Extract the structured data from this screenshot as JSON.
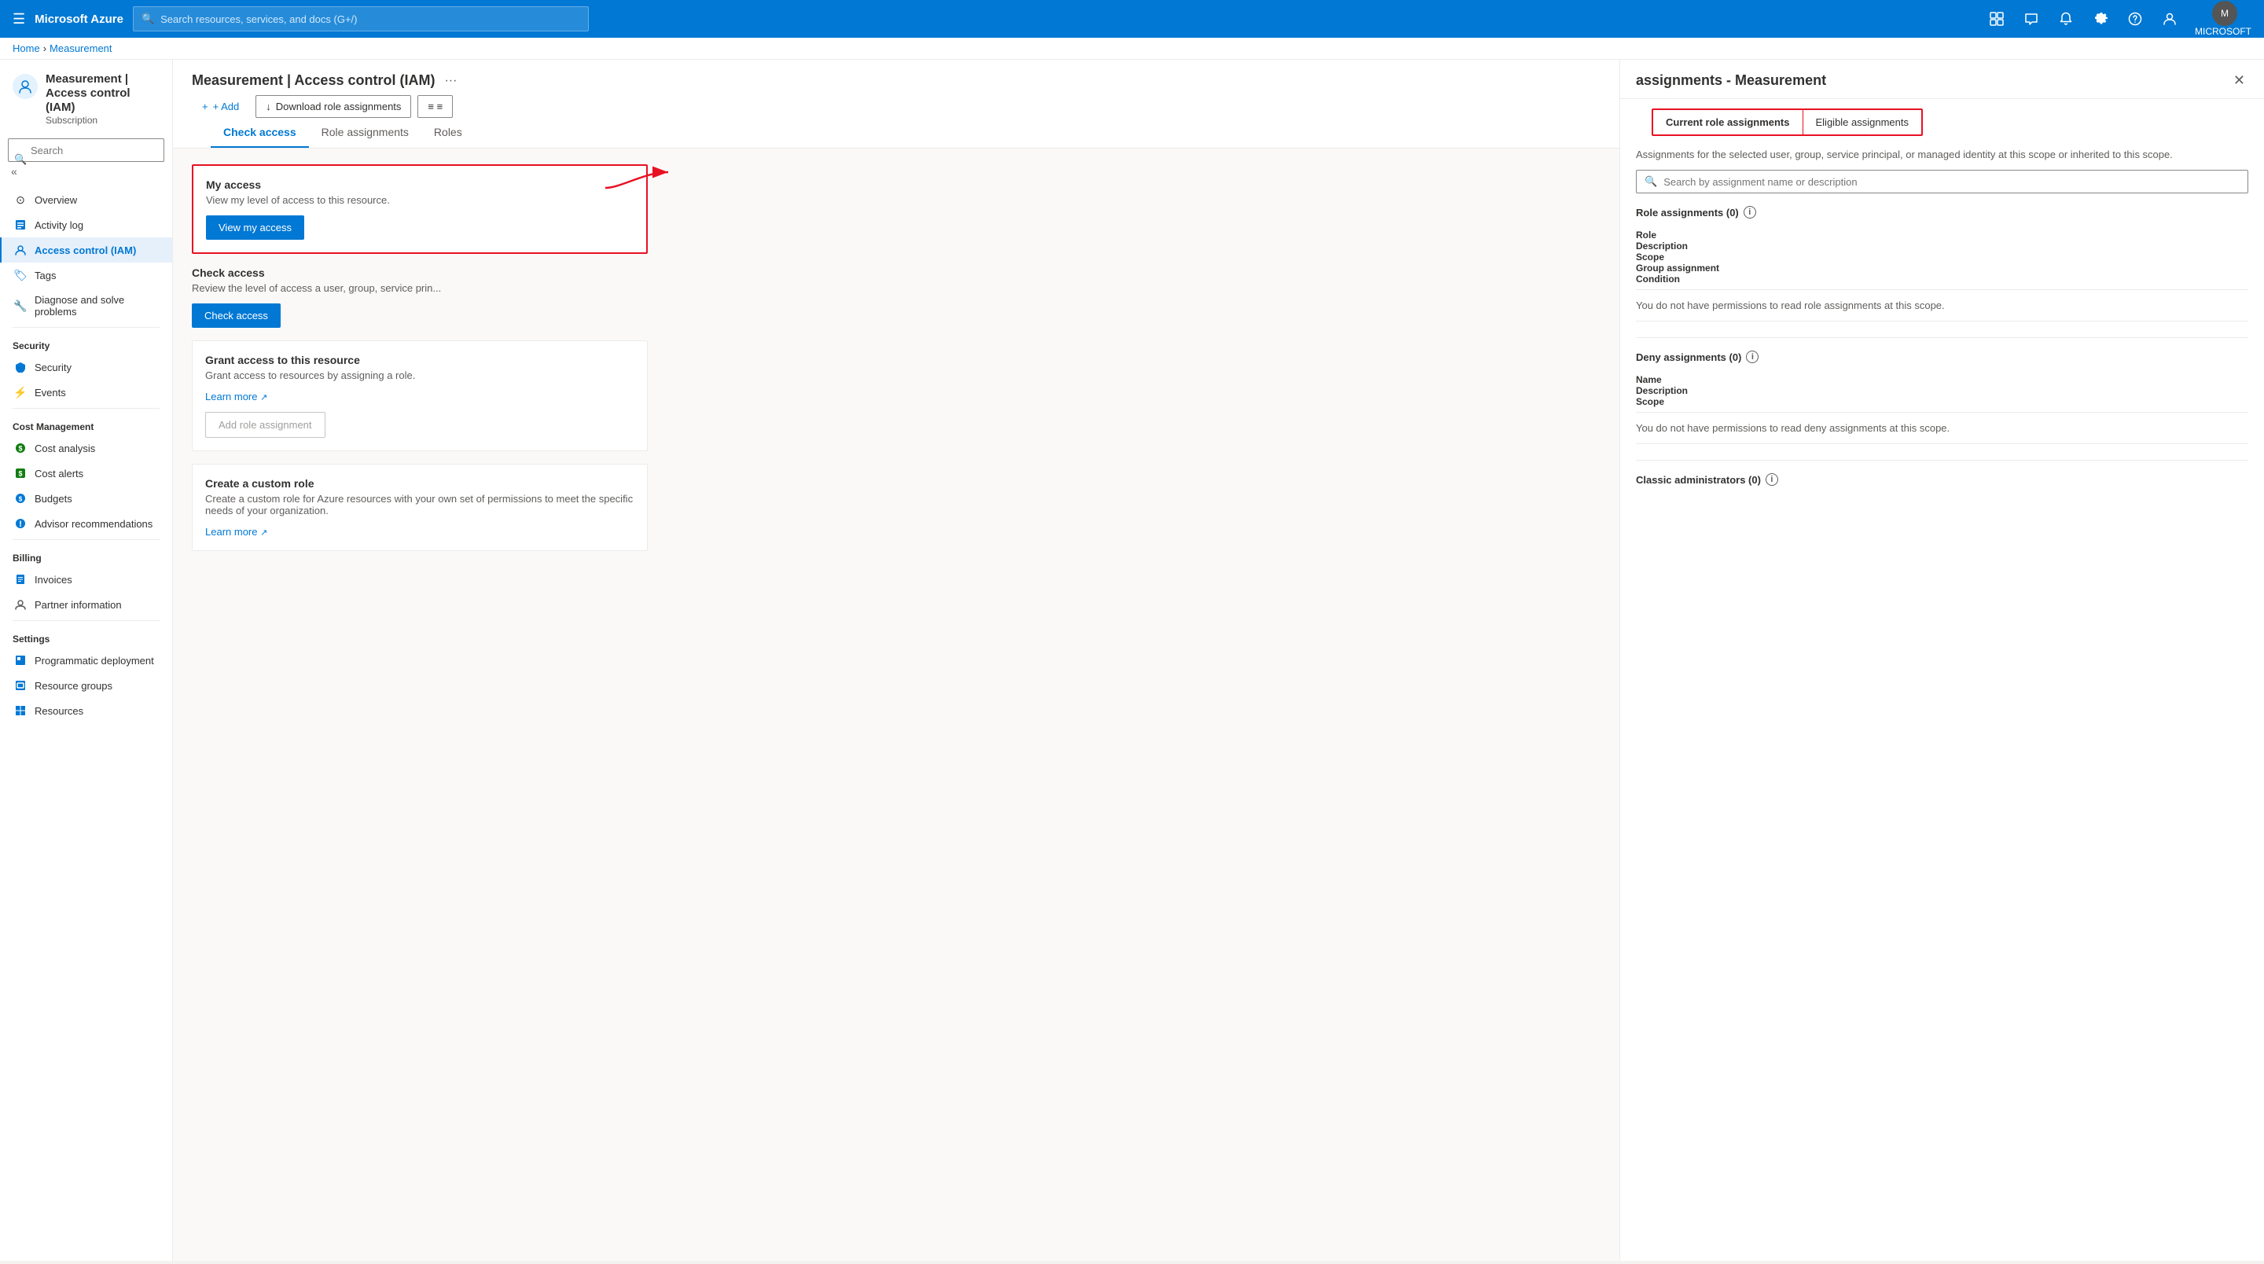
{
  "topNav": {
    "hamburger": "☰",
    "logo": "Microsoft Azure",
    "searchPlaceholder": "Search resources, services, and docs (G+/)",
    "userLabel": "MICROSOFT",
    "icons": [
      "portal",
      "feedback",
      "notifications",
      "settings",
      "help",
      "profile"
    ]
  },
  "breadcrumb": {
    "home": "Home",
    "current": "Measurement"
  },
  "sidebar": {
    "title": "Measurement | Access control (IAM)",
    "subtitle": "Subscription",
    "searchPlaceholder": "Search",
    "items": [
      {
        "id": "overview",
        "label": "Overview",
        "icon": "⊙",
        "color": "#0078d4"
      },
      {
        "id": "activity-log",
        "label": "Activity log",
        "icon": "📋",
        "color": "#0078d4"
      },
      {
        "id": "iam",
        "label": "Access control (IAM)",
        "icon": "👤",
        "color": "#0078d4",
        "active": true
      },
      {
        "id": "tags",
        "label": "Tags",
        "icon": "🏷",
        "color": "#0078d4"
      },
      {
        "id": "diagnose",
        "label": "Diagnose and solve problems",
        "icon": "🔧",
        "color": "#605e5c"
      }
    ],
    "sections": [
      {
        "label": "Security",
        "items": [
          {
            "id": "security",
            "label": "Security",
            "icon": "🛡",
            "color": "#0078d4"
          },
          {
            "id": "events",
            "label": "Events",
            "icon": "⚡",
            "color": "#f2c811"
          }
        ]
      },
      {
        "label": "Cost Management",
        "items": [
          {
            "id": "cost-analysis",
            "label": "Cost analysis",
            "icon": "💰",
            "color": "#107c10"
          },
          {
            "id": "cost-alerts",
            "label": "Cost alerts",
            "icon": "💲",
            "color": "#107c10"
          },
          {
            "id": "budgets",
            "label": "Budgets",
            "icon": "💼",
            "color": "#0078d4"
          },
          {
            "id": "advisor",
            "label": "Advisor recommendations",
            "icon": "💡",
            "color": "#0078d4"
          }
        ]
      },
      {
        "label": "Billing",
        "items": [
          {
            "id": "invoices",
            "label": "Invoices",
            "icon": "📄",
            "color": "#0078d4"
          },
          {
            "id": "partner-info",
            "label": "Partner information",
            "icon": "👤",
            "color": "#605e5c"
          }
        ]
      },
      {
        "label": "Settings",
        "items": [
          {
            "id": "programmatic",
            "label": "Programmatic deployment",
            "icon": "⬛",
            "color": "#0078d4"
          },
          {
            "id": "resource-groups",
            "label": "Resource groups",
            "icon": "⬛",
            "color": "#0078d4"
          },
          {
            "id": "resources",
            "label": "Resources",
            "icon": "⊞",
            "color": "#0078d4"
          }
        ]
      }
    ]
  },
  "pageHeader": {
    "title": "Measurement | Access control (IAM)",
    "toolbar": {
      "add": "+ Add",
      "download": "Download role assignments",
      "more": "≡ ≡"
    }
  },
  "tabs": {
    "items": [
      "Check access",
      "Role assignments",
      "Roles"
    ],
    "active": "Check access"
  },
  "checkAccess": {
    "myAccessCard": {
      "title": "My access",
      "description": "View my level of access to this resource.",
      "buttonLabel": "View my access"
    },
    "checkAccessCard": {
      "title": "Check access",
      "description": "Review the level of access a user, group, service prin...",
      "buttonLabel": "Check access"
    },
    "grantCard": {
      "title": "Grant access to this resource",
      "description": "Grant access to resources by assigning a role.",
      "learnMore": "Learn more",
      "buttonLabel": "Add role assignment"
    },
    "customRoleCard": {
      "title": "Create a custom role",
      "description": "Create a custom role for Azure resources with your own set of permissions to meet the specific needs of your organization.",
      "learnMore": "Learn more"
    }
  },
  "rightPanel": {
    "title": "assignments - Measurement",
    "tabs": [
      "Current role assignments",
      "Eligible assignments"
    ],
    "activeTab": "Current role assignments",
    "description": "Assignments for the selected user, group, service principal, or managed identity at this scope or inherited to this scope.",
    "searchPlaceholder": "Search by assignment name or description",
    "roleAssignments": {
      "label": "Role assignments",
      "count": 0,
      "columns": [
        "Role",
        "Description",
        "Scope",
        "Group assignment",
        "Condition"
      ],
      "emptyMessage": "You do not have permissions to read role assignments at this scope."
    },
    "denyAssignments": {
      "label": "Deny assignments",
      "count": 0,
      "columns": [
        "Name",
        "Description",
        "Scope"
      ],
      "emptyMessage": "You do not have permissions to read deny assignments at this scope."
    },
    "classicAdmins": {
      "label": "Classic administrators",
      "count": 0
    }
  }
}
